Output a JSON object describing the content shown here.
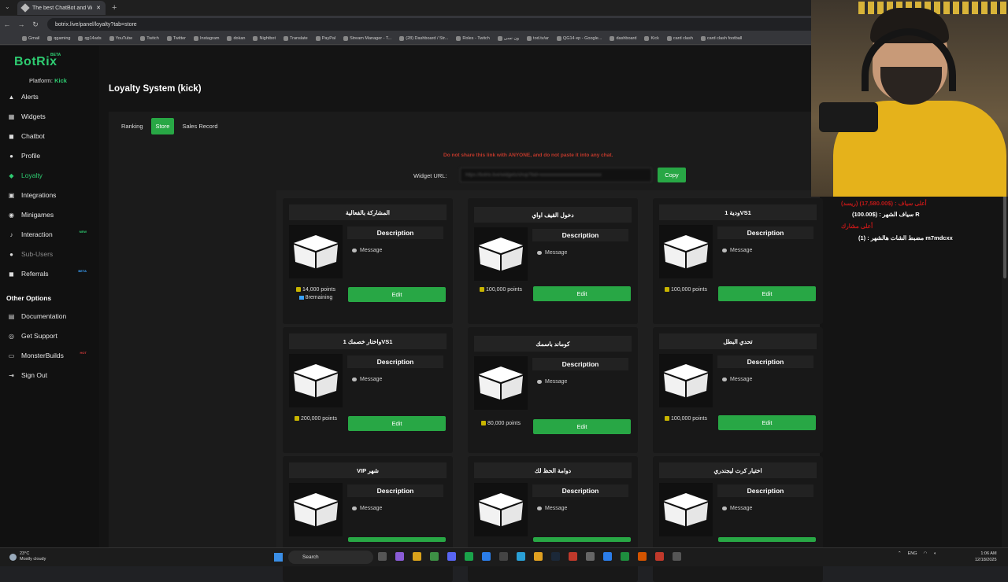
{
  "browser": {
    "tab_title": "The best ChatBot and Widgets",
    "url": "botrix.live/panel/loyalty?tab=store",
    "bookmarks": [
      "Gmail",
      "qgaming",
      "qg14ads",
      "YouTube",
      "Twitch",
      "Twitter",
      "Instagram",
      "dokan",
      "Nightbot",
      "Translate",
      "PayPal",
      "Stream Manager - T...",
      "(28) Dashboard / Str...",
      "Roles - Twitch",
      "ون نسى",
      "tod.tv/ar",
      "QG14 ep - Google...",
      "dashboard",
      "Kick",
      "card clash",
      "card clash football"
    ]
  },
  "sidebar": {
    "logo": "BotRix",
    "logo_badge": "BETA",
    "platform_label": "Platform:",
    "platform_value": "Kick",
    "items": [
      {
        "label": "Alerts",
        "icon": "alert-icon"
      },
      {
        "label": "Widgets",
        "icon": "widgets-icon"
      },
      {
        "label": "Chatbot",
        "icon": "chat-icon"
      },
      {
        "label": "Profile",
        "icon": "profile-icon"
      },
      {
        "label": "Loyalty",
        "icon": "gem-icon"
      },
      {
        "label": "Integrations",
        "icon": "integrations-icon"
      },
      {
        "label": "Minigames",
        "icon": "gamepad-icon"
      },
      {
        "label": "Interaction",
        "icon": "music-icon",
        "badge": "NEW"
      },
      {
        "label": "Sub-Users",
        "icon": "users-icon"
      },
      {
        "label": "Referrals",
        "icon": "referrals-icon",
        "badge": "BETA"
      }
    ],
    "other_heading": "Other Options",
    "other_items": [
      {
        "label": "Documentation",
        "icon": "book-icon"
      },
      {
        "label": "Get Support",
        "icon": "support-icon"
      },
      {
        "label": "MonsterBuilds",
        "icon": "monitor-icon",
        "badge": "HOT"
      },
      {
        "label": "Sign Out",
        "icon": "signout-icon"
      }
    ]
  },
  "main": {
    "title": "Loyalty System (kick)",
    "tabs": [
      "Ranking",
      "Store",
      "Sales Record"
    ],
    "active_tab": "Store",
    "warning": "Do not share this link with ANYONE, and do not paste it into any chat.",
    "widget_url_label": "Widget URL:",
    "widget_url_value": "https://botrix.live/widgets/shop?bid=xxxxxxxxxxxxxxxxxxxxxxxxxx",
    "copy_label": "Copy",
    "card_desc_label": "Description",
    "card_msg_label": "Message",
    "card_edit_label": "Edit",
    "cards": [
      {
        "title": "المشاركة بالفعالية",
        "price": "14,000 points",
        "remaining": "8remaining"
      },
      {
        "title": "دخول القيف اواي",
        "price": "100,000 points"
      },
      {
        "title": "ودية 1VS1",
        "price": "100,000 points"
      },
      {
        "title": "واختار خصمك 1VS1",
        "price": "200,000 points"
      },
      {
        "title": "كوماند باسمك",
        "price": "80,000 points"
      },
      {
        "title": "تحدي البطل",
        "price": "100,000 points"
      },
      {
        "title": "VIP شهر",
        "price": ""
      },
      {
        "title": "دوامة الحظ لك",
        "price": ""
      },
      {
        "title": "اختيار كرت ليجندري",
        "price": ""
      }
    ]
  },
  "overlay": {
    "line1": "(ريسد) أعلى سياف : ($17,580.00)",
    "line2": "سياف الشهر : ($100.00) R",
    "line3": "أعلى مشارك",
    "line4": "مضبط الشات هالشهر : (1) m7mdcxx"
  },
  "taskbar": {
    "temp": "23°C",
    "weather": "Mostly cloudy",
    "search": "Search",
    "lang": "ENG",
    "time": "1:06 AM",
    "date": "12/18/2025"
  },
  "colors": {
    "accent": "#28a745",
    "brand": "#2ecc71",
    "warning": "#c0392b"
  }
}
